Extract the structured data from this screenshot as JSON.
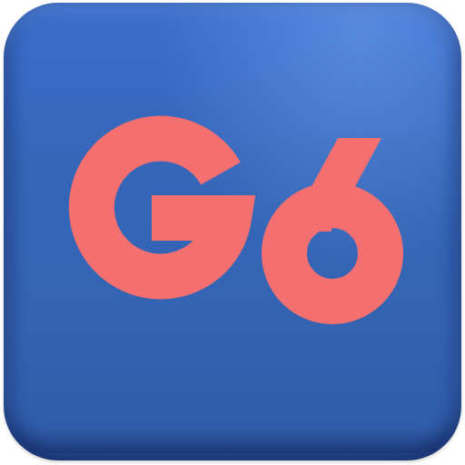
{
  "icon": {
    "glyph_text": "G6",
    "icon_name": "g6-app-icon",
    "colors": {
      "tile": "#3566b8",
      "glyph": "#f46f6f"
    }
  }
}
